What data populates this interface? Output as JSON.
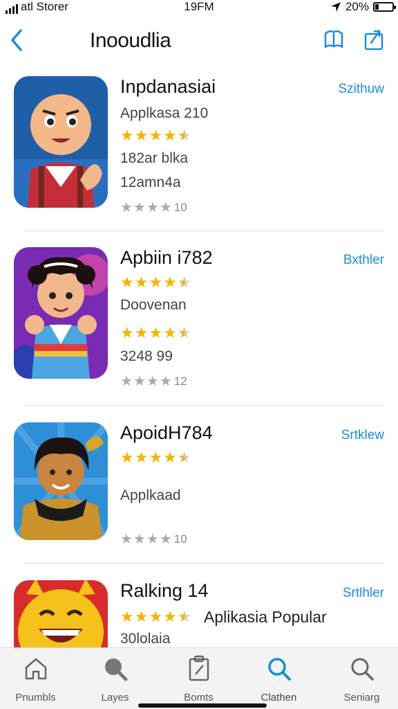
{
  "status": {
    "carrier": "atl Storer",
    "time": "19FM",
    "battery": "20%",
    "battery_level": 0.2
  },
  "nav": {
    "title": "Inooudlia"
  },
  "apps": [
    {
      "title": "Inpdanasiai",
      "action": "Szithuw",
      "line1": "Applkasa 210",
      "line2": "182ar blka",
      "line3": "12amn4a",
      "footer": "10",
      "rating": 4.5,
      "gray_rating": 4
    },
    {
      "title": "Apbiin i782",
      "action": "Bxthler",
      "line1": "Doovenan",
      "line2": "3248 99",
      "footer": "12",
      "rating": 4.5,
      "rating2": 4.5,
      "gray_rating": 4
    },
    {
      "title": "ApoidH784",
      "action": "Srtklew",
      "line1": "Applkaad",
      "footer": "10",
      "rating": 4.5,
      "gray_rating": 4
    },
    {
      "title": "Ralking 14",
      "action": "Srtlhler",
      "inline": "Aplikasia Popular",
      "line1": "30lolaia",
      "rating": 4.5
    }
  ],
  "tabs": [
    {
      "label": "Pnumbls",
      "icon": "home-icon"
    },
    {
      "label": "Layes",
      "icon": "search-filled-icon"
    },
    {
      "label": "Bomts",
      "icon": "clipboard-icon"
    },
    {
      "label": "Clathen",
      "icon": "search-icon"
    },
    {
      "label": "Seniarg",
      "icon": "search-icon"
    }
  ]
}
